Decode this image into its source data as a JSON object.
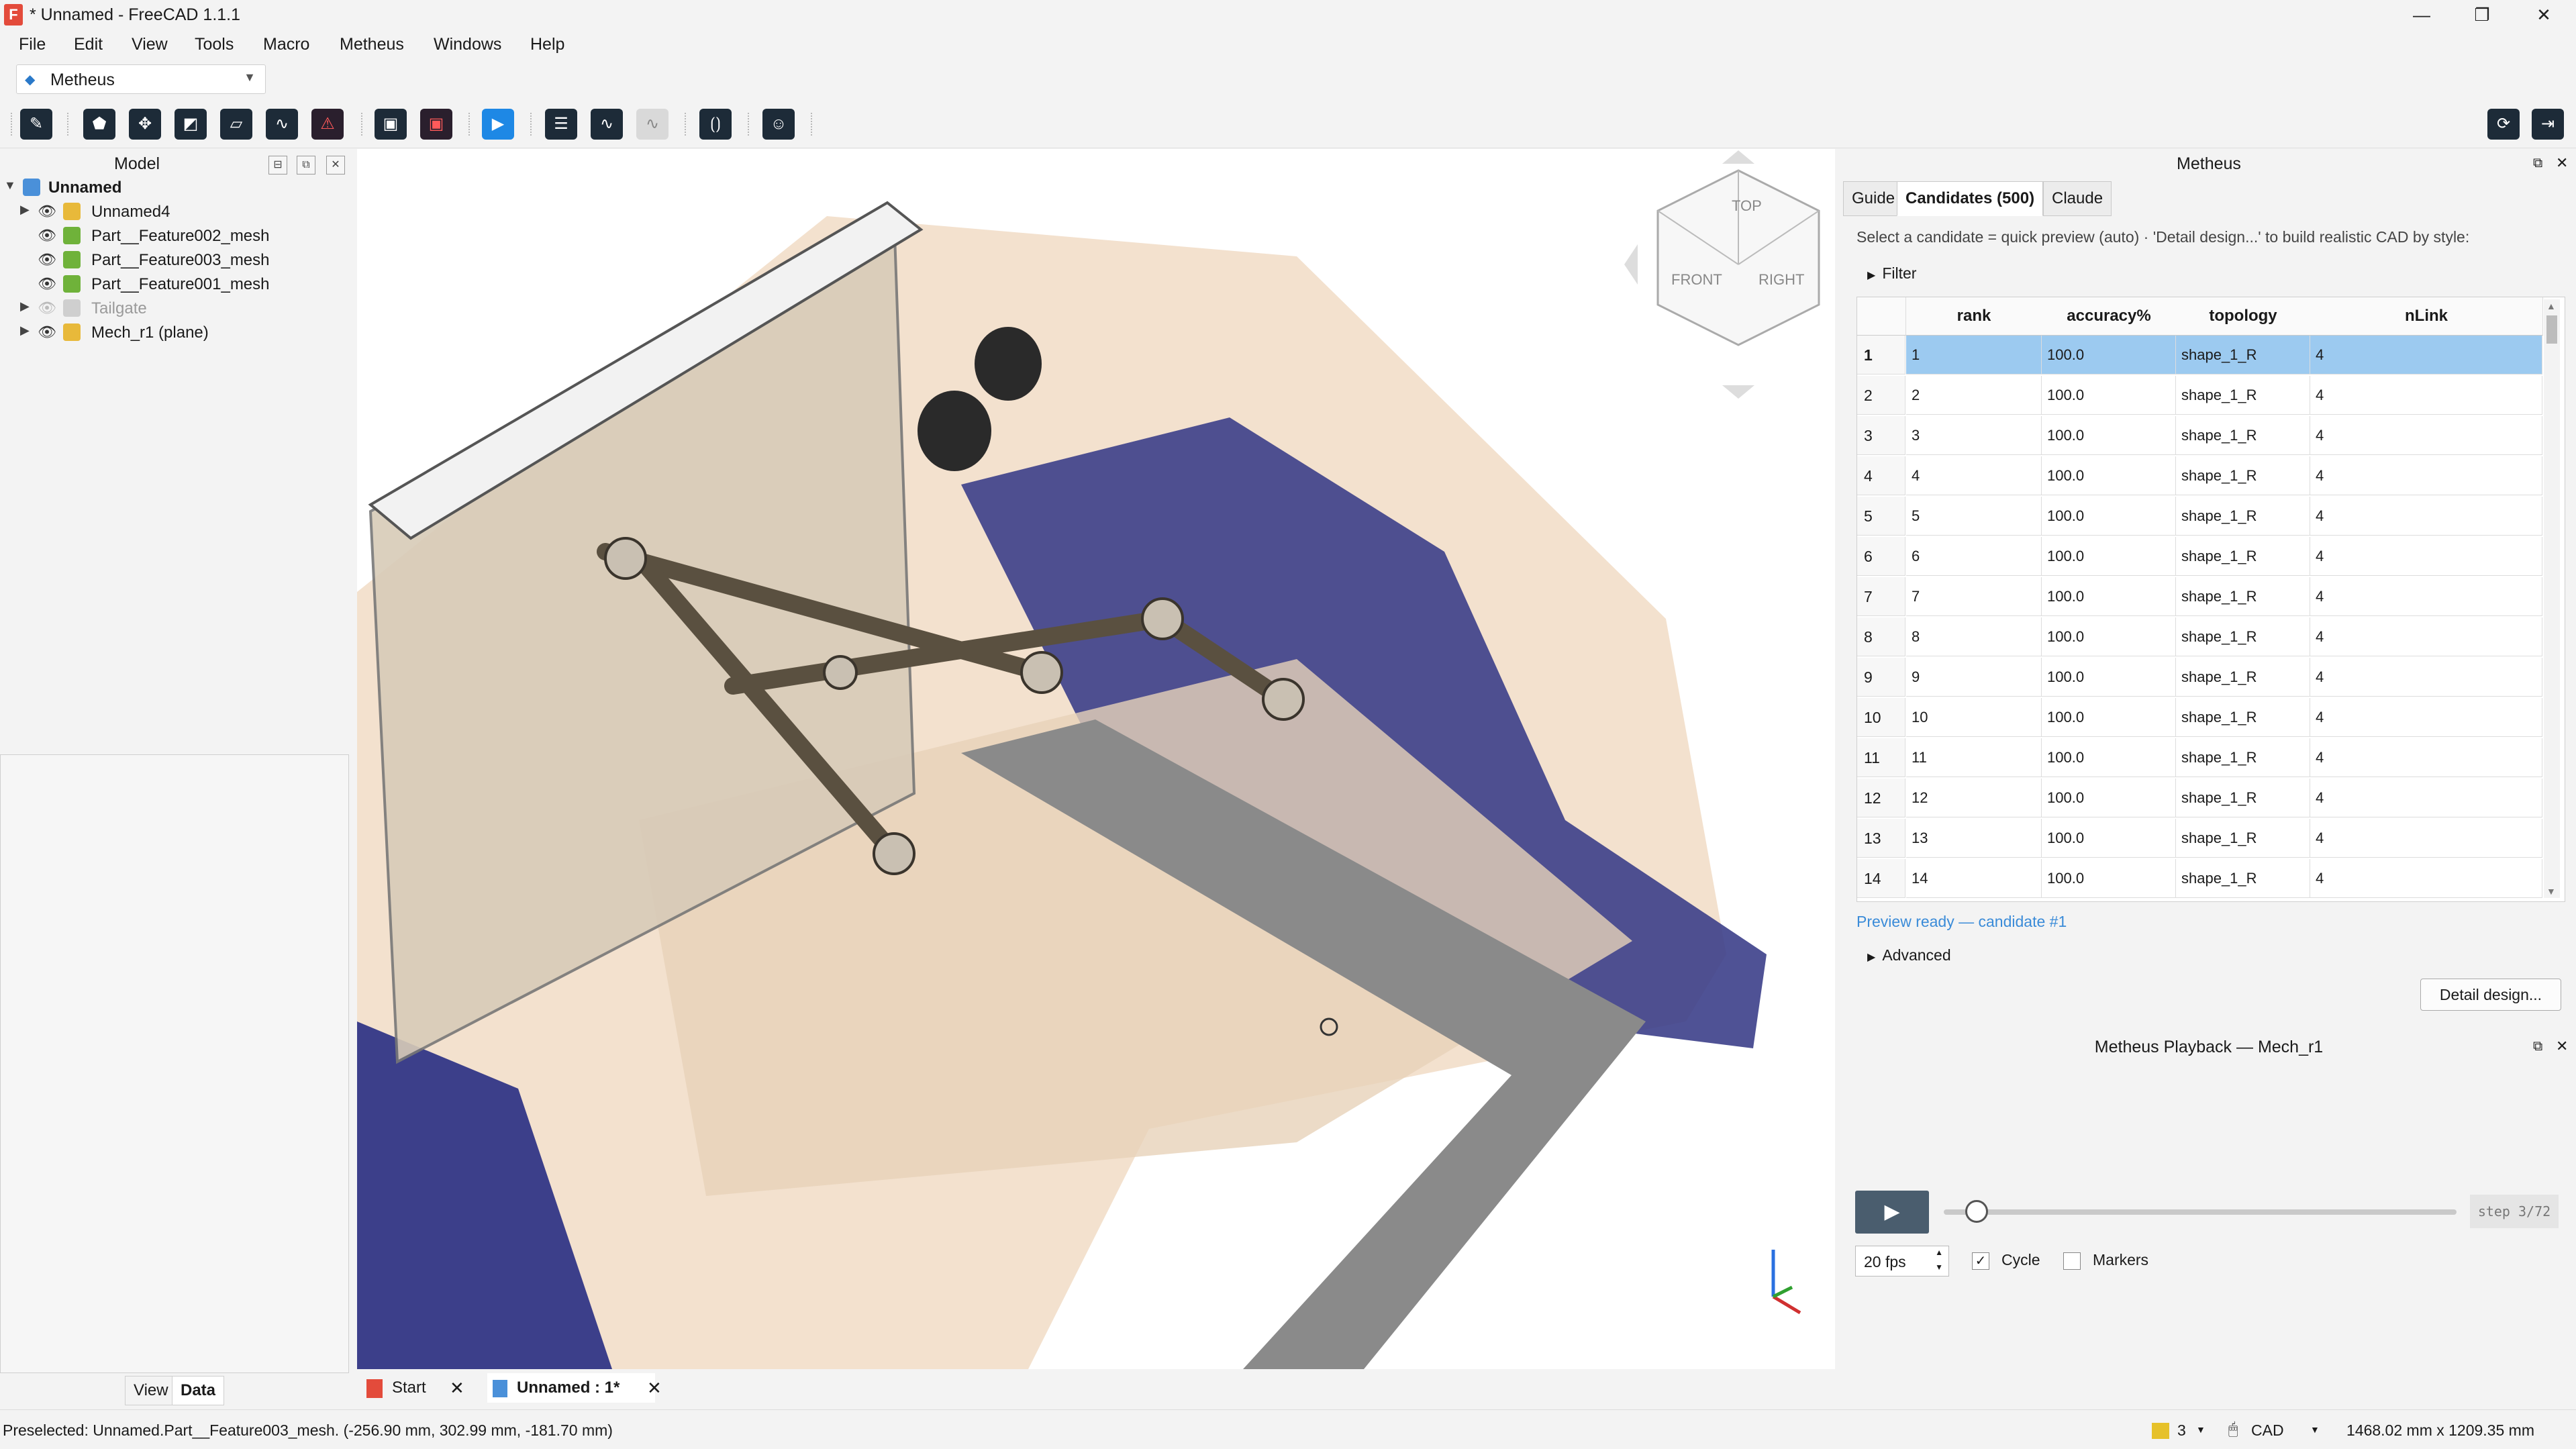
{
  "window": {
    "title": "* Unnamed - FreeCAD 1.1.1",
    "controls": [
      "—",
      "❐",
      "✕"
    ]
  },
  "menu": [
    "File",
    "Edit",
    "View",
    "Tools",
    "Macro",
    "Metheus",
    "Windows",
    "Help"
  ],
  "workbench": {
    "selected": "Metheus"
  },
  "model_panel": {
    "title": "Model",
    "tree": [
      {
        "label": "Unnamed",
        "bold": true
      },
      {
        "label": "Unnamed4"
      },
      {
        "label": "Part__Feature002_mesh"
      },
      {
        "label": "Part__Feature003_mesh"
      },
      {
        "label": "Part__Feature001_mesh"
      },
      {
        "label": "Tailgate",
        "hidden": true
      },
      {
        "label": "Mech_r1 (plane)"
      }
    ],
    "bottom_tabs": [
      "View",
      "Data"
    ]
  },
  "doc_tabs": [
    {
      "label": "Start"
    },
    {
      "label": "Unnamed : 1*"
    }
  ],
  "nav_cube": {
    "top": "TOP",
    "front": "FRONT",
    "right": "RIGHT"
  },
  "metheus": {
    "title": "Metheus",
    "tabs": [
      "Guide",
      "Candidates (500)",
      "Claude"
    ],
    "hint": "Select a candidate = quick preview (auto) · 'Detail design...' to build realistic CAD by style:",
    "filter_label": "Filter",
    "columns": [
      "rank",
      "accuracy%",
      "topology",
      "nLink"
    ],
    "rows": [
      [
        "1",
        "100.0",
        "shape_1_R",
        "4"
      ],
      [
        "2",
        "100.0",
        "shape_1_R",
        "4"
      ],
      [
        "3",
        "100.0",
        "shape_1_R",
        "4"
      ],
      [
        "4",
        "100.0",
        "shape_1_R",
        "4"
      ],
      [
        "5",
        "100.0",
        "shape_1_R",
        "4"
      ],
      [
        "6",
        "100.0",
        "shape_1_R",
        "4"
      ],
      [
        "7",
        "100.0",
        "shape_1_R",
        "4"
      ],
      [
        "8",
        "100.0",
        "shape_1_R",
        "4"
      ],
      [
        "9",
        "100.0",
        "shape_1_R",
        "4"
      ],
      [
        "10",
        "100.0",
        "shape_1_R",
        "4"
      ],
      [
        "11",
        "100.0",
        "shape_1_R",
        "4"
      ],
      [
        "12",
        "100.0",
        "shape_1_R",
        "4"
      ],
      [
        "13",
        "100.0",
        "shape_1_R",
        "4"
      ],
      [
        "14",
        "100.0",
        "shape_1_R",
        "4"
      ]
    ],
    "row_numbers": [
      "1",
      "2",
      "3",
      "4",
      "5",
      "6",
      "7",
      "8",
      "9",
      "10",
      "11",
      "12",
      "13",
      "14"
    ],
    "status": "Preview ready — candidate #1",
    "advanced_label": "Advanced",
    "detail_button": "Detail design..."
  },
  "playback": {
    "title": "Metheus Playback — Mech_r1",
    "step": "step 3/72",
    "progress": 0.0417,
    "fps": "20 fps",
    "cycle_label": "Cycle",
    "cycle_checked": true,
    "markers_label": "Markers",
    "markers_checked": false
  },
  "statusbar": {
    "text": "Preselected: Unnamed.Part__Feature003_mesh. (-256.90 mm, 302.99 mm, -181.70 mm)",
    "count": "3",
    "nav_style": "CAD",
    "dimensions": "1468.02 mm x 1209.35 mm"
  },
  "colors": {
    "selection": "#9ccaf0",
    "link": "#3a8bd8",
    "toolbar_icon": "#1d2b38",
    "body_beige": "#f1dcc5",
    "body_blue": "#3c3f8a"
  }
}
